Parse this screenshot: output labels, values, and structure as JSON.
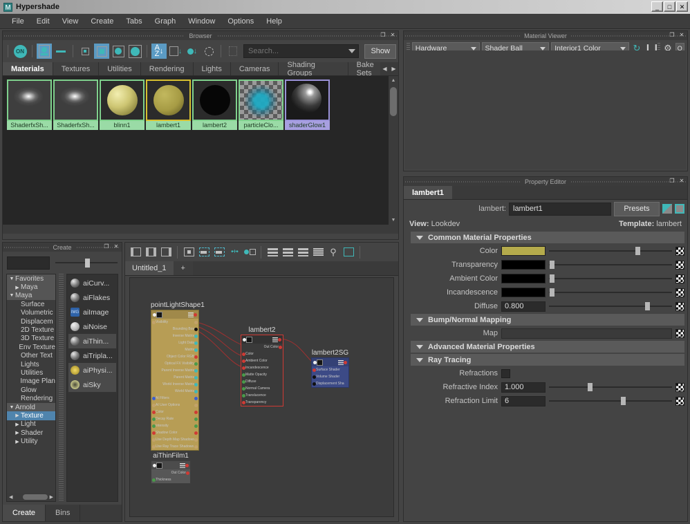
{
  "window": {
    "title": "Hypershade",
    "icon": "maya-icon",
    "controls": [
      {
        "name": "minimize-button",
        "glyph": "_"
      },
      {
        "name": "maximize-button",
        "glyph": "□"
      },
      {
        "name": "close-button",
        "glyph": "✕"
      }
    ]
  },
  "menubar": {
    "items": [
      "File",
      "Edit",
      "View",
      "Create",
      "Tabs",
      "Graph",
      "Window",
      "Options",
      "Help"
    ]
  },
  "browser": {
    "panel_title": "Browser",
    "panel_buttons": [
      "❐",
      "✕"
    ],
    "toolbar": [
      {
        "name": "toggle-on-button",
        "label": "ON",
        "active": true
      },
      {
        "name": "show-swatch-and-name-button",
        "active": true
      },
      {
        "name": "show-name-only-button",
        "active": false
      },
      {
        "name": "small-swatch-button",
        "active": false
      },
      {
        "name": "medium-swatch-button",
        "active": true
      },
      {
        "name": "large-swatch-button",
        "active": false
      },
      {
        "name": "extra-large-swatch-button",
        "active": false
      },
      {
        "name": "sort-alphabetical-button",
        "active": true
      },
      {
        "name": "sort-by-type-button",
        "active": false
      },
      {
        "name": "sort-by-time-button",
        "active": false
      },
      {
        "name": "refresh-swatches-button",
        "active": false
      },
      {
        "name": "filter-icon",
        "active": false
      }
    ],
    "search": {
      "value": "",
      "placeholder": "Search..."
    },
    "show_button": "Show",
    "tabs": [
      "Materials",
      "Textures",
      "Utilities",
      "Rendering",
      "Lights",
      "Cameras",
      "Shading Groups",
      "Bake Sets"
    ],
    "active_tab": "Materials",
    "swatches": [
      {
        "label": "ShaderfxSh...",
        "style": "sfx",
        "state": "normal"
      },
      {
        "label": "ShaderfxSh...",
        "style": "sfx",
        "state": "normal"
      },
      {
        "label": "blinn1",
        "style": "blinn",
        "state": "normal"
      },
      {
        "label": "lambert1",
        "style": "lambert1",
        "state": "selected"
      },
      {
        "label": "lambert2",
        "style": "lambert2",
        "state": "normal"
      },
      {
        "label": "particleClo...",
        "style": "pcloud",
        "state": "normal"
      },
      {
        "label": "shaderGlow1",
        "style": "glow",
        "state": "purple"
      }
    ]
  },
  "create_panel": {
    "panel_title": "Create",
    "panel_buttons": [
      "❐",
      "✕"
    ],
    "tree": [
      {
        "label": "Favorites",
        "depth": 0,
        "twisty": "▼",
        "header": true
      },
      {
        "label": "Maya",
        "depth": 1,
        "twisty": "▶",
        "header": true
      },
      {
        "label": "Maya",
        "depth": 0,
        "twisty": "▼",
        "header": true
      },
      {
        "label": "Surface",
        "depth": 1,
        "twisty": ""
      },
      {
        "label": "Volumetric",
        "depth": 1,
        "twisty": ""
      },
      {
        "label": "Displacem",
        "depth": 1,
        "twisty": ""
      },
      {
        "label": "2D Texture",
        "depth": 1,
        "twisty": ""
      },
      {
        "label": "3D Texture",
        "depth": 1,
        "twisty": ""
      },
      {
        "label": "Env Texture",
        "depth": 1,
        "twisty": ""
      },
      {
        "label": "Other Text",
        "depth": 1,
        "twisty": ""
      },
      {
        "label": "Lights",
        "depth": 1,
        "twisty": ""
      },
      {
        "label": "Utilities",
        "depth": 1,
        "twisty": ""
      },
      {
        "label": "Image Plan",
        "depth": 1,
        "twisty": ""
      },
      {
        "label": "Glow",
        "depth": 1,
        "twisty": ""
      },
      {
        "label": "Rendering",
        "depth": 1,
        "twisty": ""
      },
      {
        "label": "Arnold",
        "depth": 0,
        "twisty": "▼",
        "header": true
      },
      {
        "label": "Texture",
        "depth": 1,
        "twisty": "▶",
        "selected": true
      },
      {
        "label": "Light",
        "depth": 1,
        "twisty": "▶"
      },
      {
        "label": "Shader",
        "depth": 1,
        "twisty": "▶"
      },
      {
        "label": "Utility",
        "depth": 1,
        "twisty": "▶"
      }
    ],
    "nodes": [
      {
        "label": "aiCurv...",
        "icon": "sphere",
        "highlight": false
      },
      {
        "label": "aiFlakes",
        "icon": "sphere",
        "highlight": false
      },
      {
        "label": "aiImage",
        "icon": "image",
        "highlight": false
      },
      {
        "label": "aiNoise",
        "icon": "noise",
        "highlight": false
      },
      {
        "label": "aiThin...",
        "icon": "sphere",
        "highlight": true
      },
      {
        "label": "aiTripla...",
        "icon": "sphere",
        "highlight": false
      },
      {
        "label": "aiPhysi...",
        "icon": "phys",
        "highlight": true
      },
      {
        "label": "aiSky",
        "icon": "sky",
        "highlight": true
      }
    ],
    "bottom_tabs": [
      "Create",
      "Bins"
    ],
    "active_bottom_tab": "Create"
  },
  "graph": {
    "toolbar": [
      {
        "name": "input-connections-button"
      },
      {
        "name": "input-output-connections-button"
      },
      {
        "name": "output-connections-button"
      },
      {
        "name": "rearrange-graph-button"
      },
      {
        "name": "add-selected-to-graph-button"
      },
      {
        "name": "remove-selected-from-graph-button"
      },
      {
        "name": "clear-graph-button"
      },
      {
        "name": "show-upstream-button"
      },
      {
        "name": "layout-horizontal-button"
      },
      {
        "name": "layout-vertical-button"
      },
      {
        "name": "layout-grid-button"
      },
      {
        "name": "layout-list-button"
      },
      {
        "name": "zoom-search-button"
      },
      {
        "name": "frame-all-button"
      }
    ],
    "tabs": [
      "Untitled_1"
    ],
    "active_tab": "Untitled_1",
    "add_tab_label": "+",
    "nodes": [
      {
        "name": "pointLightShape1",
        "title": "pointLightShape1",
        "color": "#b79d55",
        "border": "#7a6a32",
        "attrs": [
          {
            "label": "Visibility",
            "left": "t",
            "right": "t"
          },
          {
            "label": "Bounding Box",
            "left": "",
            "right": "k"
          },
          {
            "label": "Inverse Matrix",
            "left": "",
            "right": "c"
          },
          {
            "label": "Light Data",
            "left": "",
            "right": "c"
          },
          {
            "label": "Matrix",
            "left": "",
            "right": "c"
          },
          {
            "label": "Object Color RGB",
            "left": "",
            "right": "r"
          },
          {
            "label": "Optical FX Visibility",
            "left": "",
            "right": "g"
          },
          {
            "label": "Parent Inverse Matrix",
            "left": "",
            "right": "c"
          },
          {
            "label": "Parent Matrix",
            "left": "",
            "right": "c"
          },
          {
            "label": "World Inverse Matrix",
            "left": "",
            "right": "c"
          },
          {
            "label": "World Matrix",
            "left": "",
            "right": "c"
          },
          {
            "label": "AI Filters",
            "left": "b",
            "right": "b"
          },
          {
            "label": "AI User Options",
            "left": "t",
            "right": "t"
          },
          {
            "label": "Color",
            "left": "r",
            "right": "r"
          },
          {
            "label": "Decay Rate",
            "left": "g",
            "right": "g"
          },
          {
            "label": "Intensity",
            "left": "g",
            "right": "g"
          },
          {
            "label": "Shadow Color",
            "left": "r",
            "right": "r"
          },
          {
            "label": "Use Depth Map Shadows",
            "left": "t",
            "right": "t"
          },
          {
            "label": "Use Ray Trace Shadows",
            "left": "t",
            "right": "t"
          }
        ]
      },
      {
        "name": "lambert2",
        "title": "lambert2",
        "color": "#3a3a3a",
        "border": "#d03a34",
        "out_label": "Out Color",
        "attrs": [
          {
            "label": "Color",
            "left": "r",
            "right": ""
          },
          {
            "label": "Ambient Color",
            "left": "r",
            "right": ""
          },
          {
            "label": "Incandescence",
            "left": "r",
            "right": ""
          },
          {
            "label": "Matte Opacity",
            "left": "g",
            "right": ""
          },
          {
            "label": "Diffuse",
            "left": "g",
            "right": ""
          },
          {
            "label": "Normal Camera",
            "left": "g",
            "right": ""
          },
          {
            "label": "Translucence",
            "left": "g",
            "right": ""
          },
          {
            "label": "Transparency",
            "left": "r",
            "right": ""
          }
        ]
      },
      {
        "name": "lambert2SG",
        "title": "lambert2SG",
        "color": "#3c4a86",
        "border": "#2b3666",
        "attrs": [
          {
            "label": "Surface Shader",
            "left": "r",
            "right": ""
          },
          {
            "label": "Volume Shader",
            "left": "k",
            "right": ""
          },
          {
            "label": "Displacement Shader",
            "left": "k",
            "right": ""
          }
        ]
      },
      {
        "name": "aiThinFilm1",
        "title": "aiThinFilm1",
        "color": "#575757",
        "border": "#3d3d3d",
        "out_label": "Out Color",
        "attrs": [
          {
            "label": "Thickness",
            "left": "g",
            "right": ""
          }
        ]
      }
    ]
  },
  "material_viewer": {
    "panel_title": "Material Viewer",
    "panel_buttons": [
      "❐",
      "✕"
    ],
    "renderer": "Hardware",
    "geometry": "Shader Ball",
    "environment": "Interior1 Color",
    "buttons": [
      {
        "name": "auto-update-button"
      },
      {
        "name": "pause-button"
      },
      {
        "name": "refresh-button"
      },
      {
        "name": "options-button"
      }
    ]
  },
  "property_editor": {
    "panel_title": "Property Editor",
    "panel_buttons": [
      "❐",
      "✕"
    ],
    "tab": "lambert1",
    "node_type_label": "lambert:",
    "node_name": "lambert1",
    "presets_button": "Presets",
    "view_label": "View:",
    "view_value": "Lookdev",
    "template_label": "Template:",
    "template_value": "lambert",
    "sections": [
      {
        "title": "Common Material Properties",
        "rows": [
          {
            "label": "Color",
            "kind": "color",
            "color": "#b5ab4c",
            "slider": 0.72
          },
          {
            "label": "Transparency",
            "kind": "color",
            "color": "#000000",
            "slider": 0.02
          },
          {
            "label": "Ambient Color",
            "kind": "color",
            "color": "#000000",
            "slider": 0.02
          },
          {
            "label": "Incandescence",
            "kind": "color",
            "color": "#000000",
            "slider": 0.02
          },
          {
            "label": "Diffuse",
            "kind": "value",
            "value": "0.800",
            "slider": 0.8
          }
        ]
      },
      {
        "title": "Bump/Normal Mapping",
        "rows": [
          {
            "label": "Map",
            "kind": "map",
            "value": ""
          }
        ]
      },
      {
        "title": "Advanced Material Properties",
        "rows": []
      },
      {
        "title": "Ray Tracing",
        "rows": [
          {
            "label": "Refractions",
            "kind": "checkbox",
            "checked": false
          },
          {
            "label": "Refractive Index",
            "kind": "value",
            "value": "1.000",
            "slider": 0.33
          },
          {
            "label": "Refraction Limit",
            "kind": "value",
            "value": "6",
            "slider": 0.6
          }
        ]
      }
    ]
  }
}
